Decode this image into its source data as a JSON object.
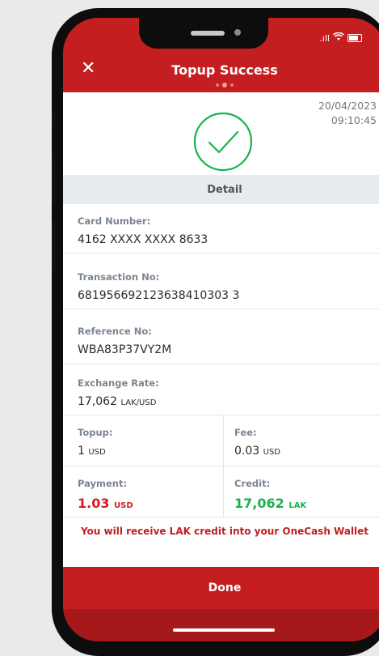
{
  "header": {
    "title": "Topup Success",
    "close_icon": "close-icon"
  },
  "status_bar": {
    "signal_icon": ".ıll",
    "wifi_icon": "wifi-icon"
  },
  "transaction": {
    "date": "20/04/2023",
    "time": "09:10:45"
  },
  "section_title": "Detail",
  "fields": {
    "card_number_label": "Card Number:",
    "card_number": "4162 XXXX XXXX 8633",
    "transaction_no_label": "Transaction No:",
    "transaction_no": "681956692123638410303 3",
    "reference_no_label": "Reference No:",
    "reference_no": "WBA83P37VY2M",
    "exchange_rate_label": "Exchange Rate:",
    "exchange_rate": "17,062",
    "exchange_rate_unit": "LAK/USD",
    "topup_label": "Topup:",
    "topup_value": "1",
    "topup_unit": "USD",
    "fee_label": "Fee:",
    "fee_value": "0.03",
    "fee_unit": "USD",
    "payment_label": "Payment:",
    "payment_value": "1.03",
    "payment_unit": "USD",
    "credit_label": "Credit:",
    "credit_value": "17,062",
    "credit_unit": "LAK"
  },
  "notice": "You will receive LAK credit into your OneCash Wallet",
  "done_label": "Done",
  "colors": {
    "brand_red": "#c41e20",
    "success_green": "#1ab24b",
    "payment_red": "#d21c22"
  }
}
